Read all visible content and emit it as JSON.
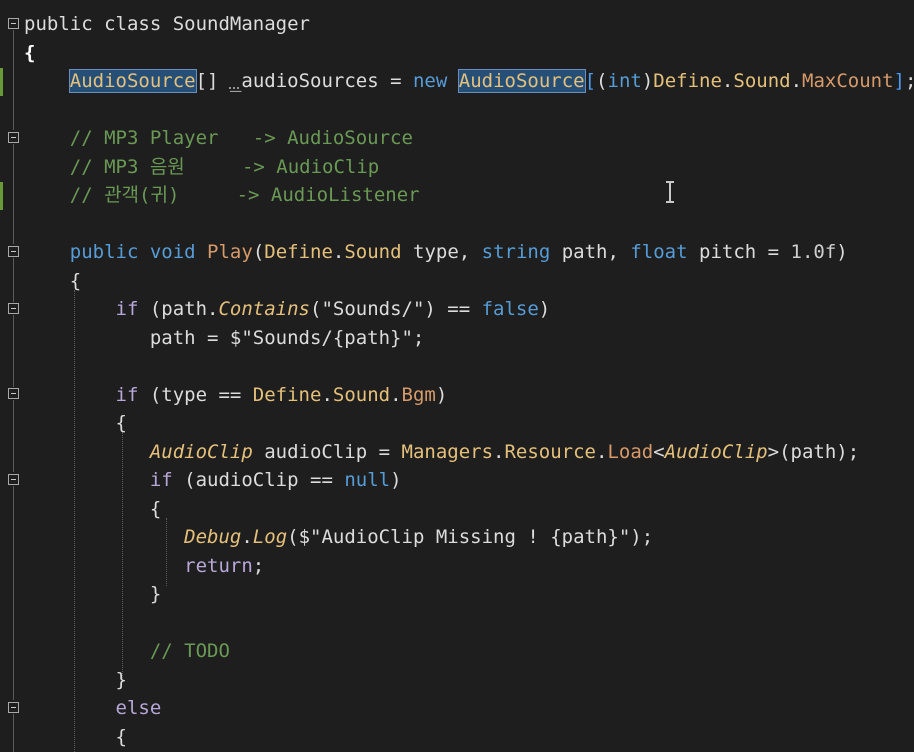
{
  "editor": {
    "lines": [
      [
        {
          "t": "public class SoundManager",
          "c": "tk-plain"
        }
      ],
      [
        {
          "t": "{",
          "c": "tk-bold"
        }
      ],
      [
        {
          "t": "    ",
          "c": "tk-plain"
        },
        {
          "t": "AudioSource",
          "c": "tk-type hl"
        },
        {
          "t": "[] ",
          "c": "tk-plain"
        },
        {
          "t": "_",
          "c": "tk-plain dotted-under"
        },
        {
          "t": "audioSources = ",
          "c": "tk-plain"
        },
        {
          "t": "new ",
          "c": "tk-kw"
        },
        {
          "t": "AudioSource",
          "c": "tk-type hl"
        },
        {
          "t": "[",
          "c": "blueplain"
        },
        {
          "t": "(",
          "c": "tk-plain"
        },
        {
          "t": "int",
          "c": "tk-kw"
        },
        {
          "t": ")",
          "c": "tk-plain"
        },
        {
          "t": "Define",
          "c": "tk-type"
        },
        {
          "t": ".",
          "c": "tk-plain"
        },
        {
          "t": "Sound",
          "c": "tk-type"
        },
        {
          "t": ".",
          "c": "tk-plain"
        },
        {
          "t": "MaxCount",
          "c": "tk-enum"
        },
        {
          "t": "]",
          "c": "blueplain"
        },
        {
          "t": ";",
          "c": "tk-plain"
        }
      ],
      [],
      [
        {
          "t": "    // MP3 Player   -> AudioSource",
          "c": "tk-cm"
        }
      ],
      [
        {
          "t": "    // MP3 음원     -> AudioClip",
          "c": "tk-cm"
        }
      ],
      [
        {
          "t": "    // 관객(귀)     -> AudioListener",
          "c": "tk-cm"
        }
      ],
      [],
      [
        {
          "t": "    ",
          "c": "tk-plain"
        },
        {
          "t": "public void ",
          "c": "tk-kw"
        },
        {
          "t": "Play",
          "c": "tk-enum"
        },
        {
          "t": "(",
          "c": "tk-plain"
        },
        {
          "t": "Define",
          "c": "tk-type"
        },
        {
          "t": ".",
          "c": "tk-plain"
        },
        {
          "t": "Sound ",
          "c": "tk-type"
        },
        {
          "t": "type, ",
          "c": "tk-plain"
        },
        {
          "t": "string ",
          "c": "tk-kw"
        },
        {
          "t": "path, ",
          "c": "tk-plain"
        },
        {
          "t": "float ",
          "c": "tk-kw"
        },
        {
          "t": "pitch = ",
          "c": "tk-plain"
        },
        {
          "t": "1.0f",
          "c": "tk-num"
        },
        {
          "t": ")",
          "c": "tk-plain"
        }
      ],
      [
        {
          "t": "    {",
          "c": "tk-plain"
        }
      ],
      [
        {
          "t": "        ",
          "c": "tk-plain"
        },
        {
          "t": "if ",
          "c": "tk-ctl"
        },
        {
          "t": "(path.",
          "c": "tk-plain"
        },
        {
          "t": "Contains",
          "c": "tk-ital"
        },
        {
          "t": "(\"Sounds/\") == ",
          "c": "tk-plain"
        },
        {
          "t": "false",
          "c": "tk-kw"
        },
        {
          "t": ")",
          "c": "tk-plain"
        }
      ],
      [
        {
          "t": "           path = $\"Sounds/{path}\";",
          "c": "tk-plain"
        }
      ],
      [],
      [
        {
          "t": "        ",
          "c": "tk-plain"
        },
        {
          "t": "if ",
          "c": "tk-ctl"
        },
        {
          "t": "(type == ",
          "c": "tk-plain"
        },
        {
          "t": "Define",
          "c": "tk-type"
        },
        {
          "t": ".",
          "c": "tk-plain"
        },
        {
          "t": "Sound",
          "c": "tk-type"
        },
        {
          "t": ".",
          "c": "tk-plain"
        },
        {
          "t": "Bgm",
          "c": "tk-enum"
        },
        {
          "t": ")",
          "c": "tk-plain"
        }
      ],
      [
        {
          "t": "        {",
          "c": "tk-plain"
        }
      ],
      [
        {
          "t": "           ",
          "c": "tk-plain"
        },
        {
          "t": "AudioClip",
          "c": "tk-ital"
        },
        {
          "t": " audioClip = ",
          "c": "tk-plain"
        },
        {
          "t": "Managers",
          "c": "tk-type"
        },
        {
          "t": ".",
          "c": "tk-plain"
        },
        {
          "t": "Resource",
          "c": "tk-type"
        },
        {
          "t": ".",
          "c": "tk-plain"
        },
        {
          "t": "Load",
          "c": "tk-enum"
        },
        {
          "t": "<",
          "c": "tk-plain"
        },
        {
          "t": "AudioClip",
          "c": "tk-ital"
        },
        {
          "t": ">(path);",
          "c": "tk-plain"
        }
      ],
      [
        {
          "t": "           ",
          "c": "tk-plain"
        },
        {
          "t": "if ",
          "c": "tk-ctl"
        },
        {
          "t": "(audioClip == ",
          "c": "tk-plain"
        },
        {
          "t": "null",
          "c": "tk-kw"
        },
        {
          "t": ")",
          "c": "tk-plain"
        }
      ],
      [
        {
          "t": "           {",
          "c": "tk-plain"
        }
      ],
      [
        {
          "t": "              ",
          "c": "tk-plain"
        },
        {
          "t": "Debug",
          "c": "tk-ital"
        },
        {
          "t": ".",
          "c": "tk-plain"
        },
        {
          "t": "Log",
          "c": "tk-ital"
        },
        {
          "t": "($\"AudioClip Missing ! {path}\");",
          "c": "tk-plain"
        }
      ],
      [
        {
          "t": "              ",
          "c": "tk-plain"
        },
        {
          "t": "return",
          "c": "tk-ctl"
        },
        {
          "t": ";",
          "c": "tk-plain"
        }
      ],
      [
        {
          "t": "           }",
          "c": "tk-plain"
        }
      ],
      [],
      [
        {
          "t": "           // TODO",
          "c": "tk-cm"
        }
      ],
      [
        {
          "t": "        }",
          "c": "tk-plain"
        }
      ],
      [
        {
          "t": "        ",
          "c": "tk-plain"
        },
        {
          "t": "else",
          "c": "tk-ctl"
        }
      ],
      [
        {
          "t": "        {",
          "c": "tk-plain"
        }
      ]
    ]
  }
}
